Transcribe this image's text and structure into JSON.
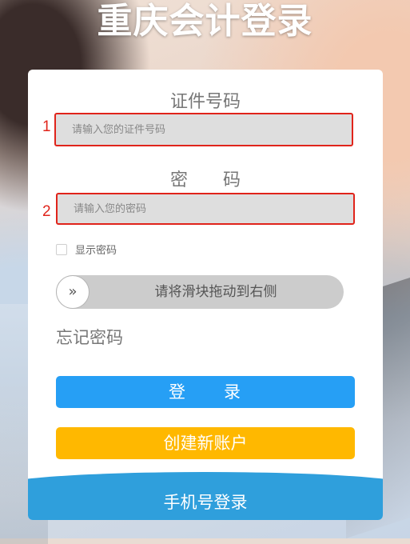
{
  "page": {
    "title": "重庆会计登录"
  },
  "form": {
    "id_label": "证件号码",
    "id_placeholder": "请输入您的证件号码",
    "password_label": "密　　码",
    "password_placeholder": "请输入您的密码",
    "show_password_label": "显示密码",
    "slider_text": "请将滑块拖动到右侧",
    "slider_icon": "double-chevron-right-icon",
    "forgot_password": "忘记密码",
    "login_button": "登　　录",
    "register_button": "创建新账户",
    "phone_login": "手机号登录"
  },
  "annotations": {
    "marker_1": "1",
    "marker_2": "2"
  },
  "colors": {
    "annotation_red": "#e0241b",
    "login_blue": "#269ff5",
    "register_yellow": "#ffb800",
    "phone_login_blue": "#2f9fdc",
    "slider_gray": "#cccccc"
  }
}
